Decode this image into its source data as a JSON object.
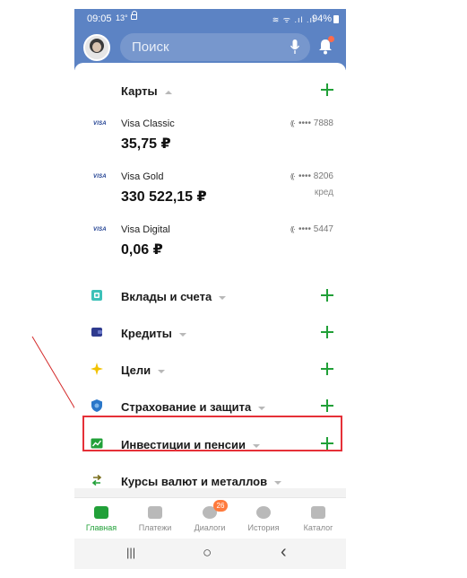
{
  "status": {
    "time": "09:05",
    "temp": "13°",
    "icons": "≋ ᯤ .ıl .ıl",
    "battery": "94%"
  },
  "header": {
    "search_placeholder": "Поиск"
  },
  "cards_section": {
    "title": "Карты"
  },
  "accounts": [
    {
      "brand": "VISA",
      "name": "Visa Classic",
      "balance": "35,75 ₽",
      "number": "•••• 7888",
      "sub": ""
    },
    {
      "brand": "VISA",
      "name": "Visa Gold",
      "balance": "330 522,15 ₽",
      "number": "•••• 8206",
      "sub": "кред"
    },
    {
      "brand": "VISA",
      "name": "Visa Digital",
      "balance": "0,06 ₽",
      "number": "•••• 5447",
      "sub": ""
    }
  ],
  "nfc_glyph": "((·",
  "sections": [
    {
      "label": "Вклады и счета",
      "icon": "deposit-icon",
      "color": "#3cc1b8"
    },
    {
      "label": "Кредиты",
      "icon": "wallet-icon",
      "color": "#2f3b8f"
    },
    {
      "label": "Цели",
      "icon": "star-icon",
      "color": "#f2c200"
    },
    {
      "label": "Страхование и защита",
      "icon": "shield-icon",
      "color": "#2a77c9"
    },
    {
      "label": "Инвестиции и пенсии",
      "icon": "chart-icon",
      "color": "#21a038"
    },
    {
      "label": "Курсы валют и металлов",
      "icon": "exchange-icon",
      "color": "#7a6f1e"
    }
  ],
  "tabs": [
    {
      "label": "Главная",
      "icon": "home-icon",
      "active": true
    },
    {
      "label": "Платежи",
      "icon": "payments-icon",
      "active": false
    },
    {
      "label": "Диалоги",
      "icon": "chat-icon",
      "active": false,
      "badge": "26"
    },
    {
      "label": "История",
      "icon": "history-icon",
      "active": false
    },
    {
      "label": "Каталог",
      "icon": "cart-icon",
      "active": false
    }
  ],
  "navbar": {
    "recent": "|||",
    "home": "○",
    "back": "‹"
  },
  "colors": {
    "brand_blue": "#5c83c4",
    "accent_green": "#21a038",
    "highlight_red": "#e53038"
  }
}
